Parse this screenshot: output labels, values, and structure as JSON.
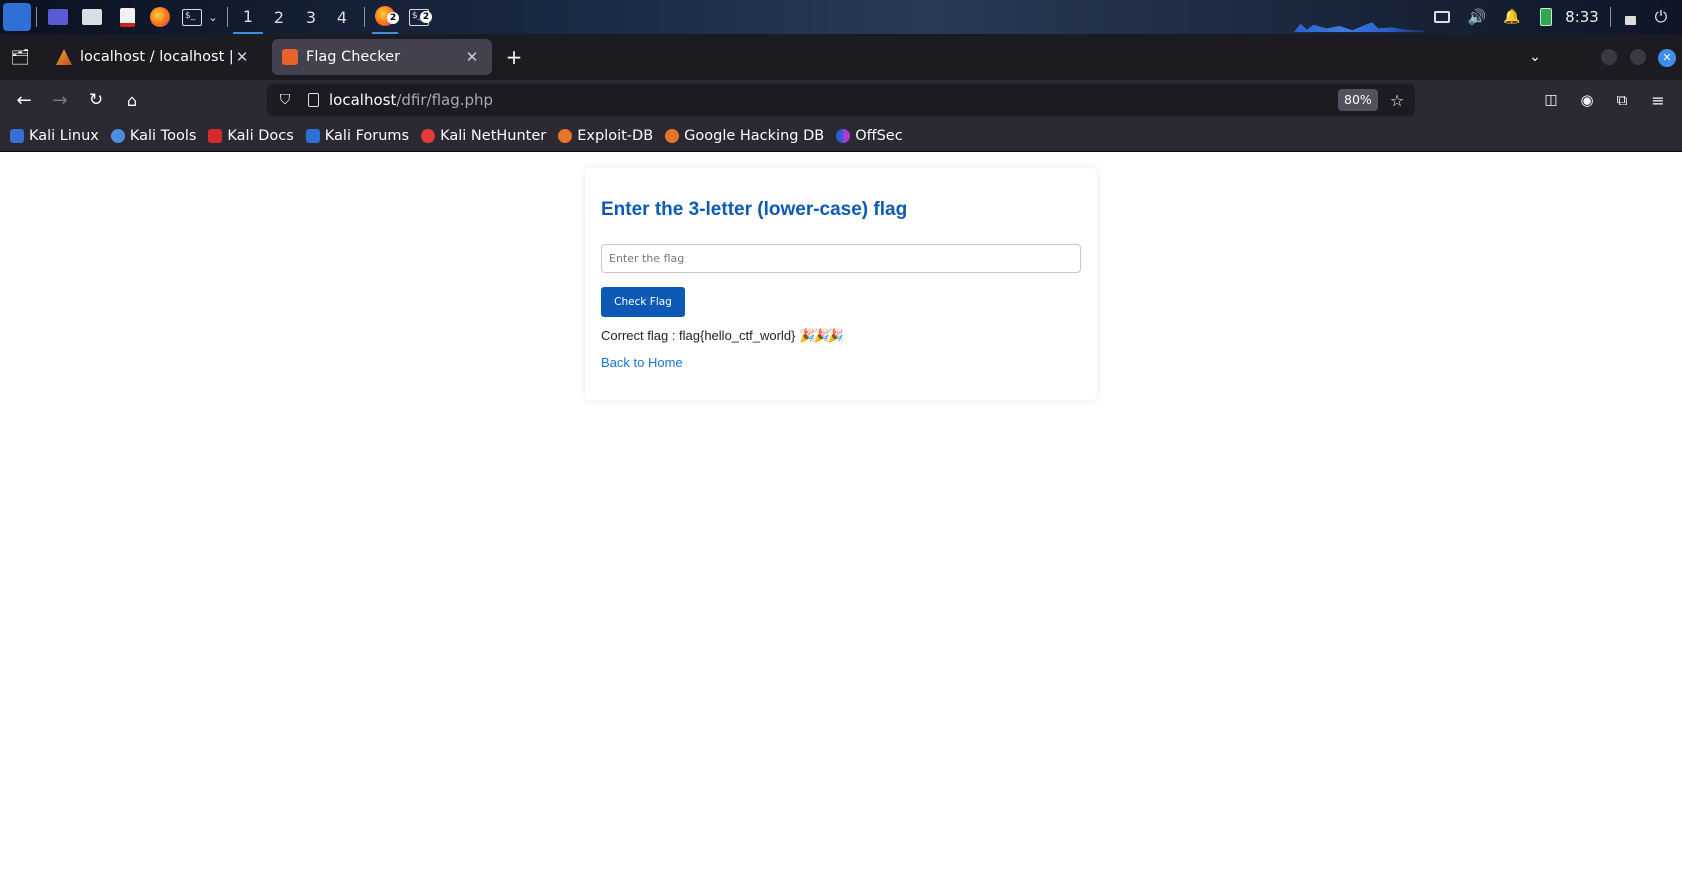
{
  "panel": {
    "workspaces": [
      "1",
      "2",
      "3",
      "4"
    ],
    "active_workspace": "1",
    "taskbar_badges": {
      "firefox": "2",
      "terminal": "2"
    },
    "clock": "8:33"
  },
  "browser": {
    "tabs": [
      {
        "label": "localhost / localhost | phpMyAdmin",
        "active": false
      },
      {
        "label": "Flag Checker",
        "active": true
      }
    ],
    "url_host": "localhost",
    "url_path": "/dfir/flag.php",
    "zoom": "80%",
    "bookmarks": [
      {
        "label": "Kali Linux",
        "icon": "kali-dragon-icon"
      },
      {
        "label": "Kali Tools",
        "icon": "kali-tools-icon"
      },
      {
        "label": "Kali Docs",
        "icon": "kali-docs-icon"
      },
      {
        "label": "Kali Forums",
        "icon": "kali-forums-icon"
      },
      {
        "label": "Kali NetHunter",
        "icon": "nethunter-icon"
      },
      {
        "label": "Exploit-DB",
        "icon": "exploit-db-icon"
      },
      {
        "label": "Google Hacking DB",
        "icon": "ghdb-icon"
      },
      {
        "label": "OffSec",
        "icon": "offsec-icon"
      }
    ]
  },
  "page": {
    "heading": "Enter the 3-letter (lower-case) flag",
    "input_placeholder": "Enter the flag",
    "input_value": "",
    "button_label": "Check Flag",
    "result_text": "Correct flag : flag{hello_ctf_world}",
    "result_emoji": "🎉🎉🎉",
    "back_link": "Back to Home"
  },
  "colors": {
    "accent": "#0c5ab5",
    "link": "#1a73c8",
    "browser_chrome": "#2b2a33",
    "tab_strip": "#1c1b22"
  }
}
